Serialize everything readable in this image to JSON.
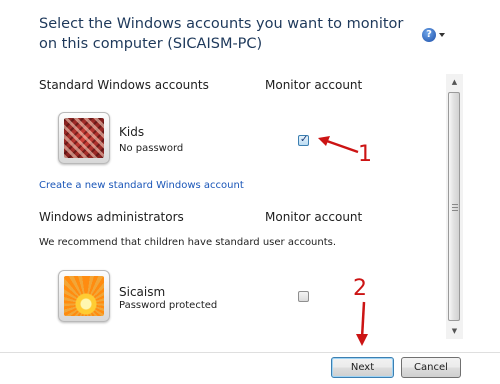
{
  "header": {
    "title": "Select the Windows accounts you want to monitor on this computer (SICAISM-PC)",
    "help_glyph": "?"
  },
  "standard_section": {
    "heading": "Standard Windows accounts",
    "column_heading": "Monitor account",
    "accounts": [
      {
        "name": "Kids",
        "status": "No password",
        "monitored": true
      }
    ],
    "create_link": "Create a new standard Windows account"
  },
  "admin_section": {
    "heading": "Windows administrators",
    "column_heading": "Monitor account",
    "note": "We recommend that children have standard user accounts.",
    "accounts": [
      {
        "name": "Sicaism",
        "status": "Password protected",
        "monitored": false
      }
    ]
  },
  "annotations": {
    "first": "1",
    "second": "2",
    "color": "#cc1414"
  },
  "buttons": {
    "next": "Next",
    "cancel": "Cancel"
  },
  "icons": {
    "help": "help-icon",
    "scroll_up": "scroll-up-arrow",
    "scroll_down": "scroll-down-arrow"
  }
}
